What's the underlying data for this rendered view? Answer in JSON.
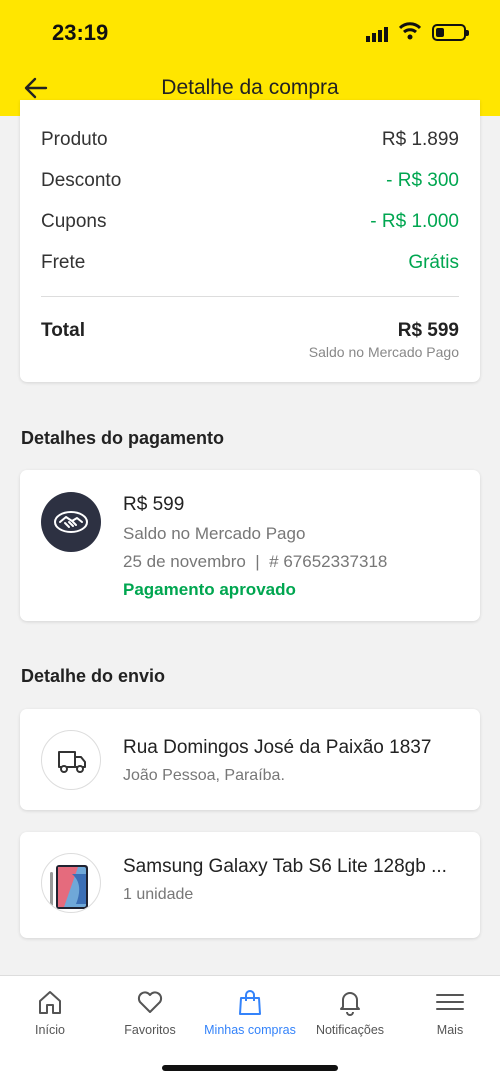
{
  "status_bar": {
    "time": "23:19"
  },
  "header": {
    "title": "Detalhe da compra"
  },
  "summary": {
    "rows": [
      {
        "label": "Produto",
        "value": "R$ 1.899"
      },
      {
        "label": "Desconto",
        "value": "- R$ 300"
      },
      {
        "label": "Cupons",
        "value": "- R$ 1.000"
      },
      {
        "label": "Frete",
        "value": "Grátis"
      }
    ],
    "total_label": "Total",
    "total_value": "R$ 599",
    "total_note": "Saldo no Mercado Pago"
  },
  "payment": {
    "section_title": "Detalhes do pagamento",
    "amount": "R$ 599",
    "method": "Saldo no Mercado Pago",
    "date_and_id": "25 de novembro  |  # 67652337318",
    "status": "Pagamento aprovado",
    "icon": "handshake-icon"
  },
  "shipping": {
    "section_title": "Detalhe do envio",
    "address": "Rua Domingos José da Paixão 1837",
    "city": "João Pessoa, Paraíba.",
    "icon": "truck-icon"
  },
  "product": {
    "name": "Samsung Galaxy Tab S6 Lite 128gb ...",
    "quantity": "1 unidade"
  },
  "tabbar": {
    "items": [
      {
        "label": "Início",
        "icon": "home-icon"
      },
      {
        "label": "Favoritos",
        "icon": "heart-icon"
      },
      {
        "label": "Minhas compras",
        "icon": "shopping-bag-icon",
        "active": true
      },
      {
        "label": "Notificações",
        "icon": "bell-icon"
      },
      {
        "label": "Mais",
        "icon": "menu-icon"
      }
    ]
  },
  "colors": {
    "brand_yellow": "#ffe600",
    "success_green": "#00a650",
    "active_blue": "#3483fa",
    "icon_dark": "#2d3142"
  }
}
